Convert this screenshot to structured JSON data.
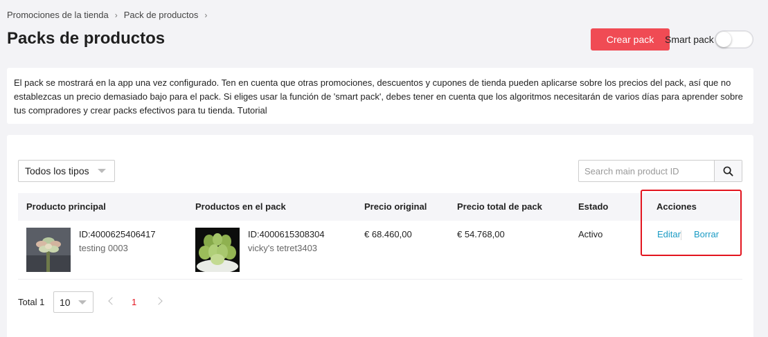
{
  "breadcrumb": {
    "items": [
      "Promociones de la tienda",
      "Pack de productos"
    ]
  },
  "page_title": "Packs de productos",
  "header": {
    "create_button": "Crear pack",
    "smart_pack_label": "Smart pack",
    "smart_pack_enabled": false
  },
  "info_text": "El pack se mostrará en la app una vez configurado. Ten en cuenta que otras promociones, descuentos y cupones de tienda pueden aplicarse sobre los precios del pack, así que no establezcas un precio demasiado bajo para el pack. Si eliges usar la función de 'smart pack', debes tener en cuenta que los algoritmos necesitarán de varios días para aprender sobre tus compradores y crear packs efectivos para tu tienda. Tutorial",
  "filters": {
    "type_selected": "Todos los tipos",
    "search_placeholder": "Search main product ID",
    "search_icon": "search-icon"
  },
  "table": {
    "headers": [
      "Producto principal",
      "Productos en el pack",
      "Precio original",
      "Precio total de pack",
      "Estado",
      "Acciones"
    ],
    "rows": [
      {
        "main_product_id": "ID:4000625406417",
        "main_product_name": "testing 0003",
        "pack_product_id": "ID:4000615308304",
        "pack_product_name": "vicky's tetret3403",
        "original_price": "€ 68.460,00",
        "pack_price": "€ 54.768,00",
        "status": "Activo",
        "actions": [
          "Editar",
          "Borrar"
        ]
      }
    ]
  },
  "pagination": {
    "total_label": "Total 1",
    "page_size": "10",
    "current_page": "1"
  },
  "colors": {
    "accent": "#f04b54",
    "link": "#1a9bc4",
    "highlight": "#e3141e"
  }
}
